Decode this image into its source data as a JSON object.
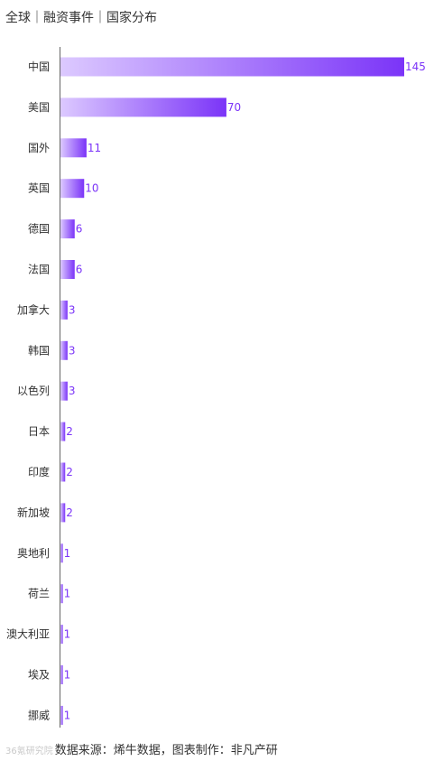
{
  "title": "全球｜融资事件｜国家分布",
  "footer": {
    "watermark": "36氪研究院",
    "source": "数据来源：烯牛数据，图表制作：非凡产研"
  },
  "colors": {
    "bar_start": "#dcc9ff",
    "bar_end": "#7b34f8",
    "label": "#7b34f8",
    "axis": "#666666",
    "text": "#333333"
  },
  "chart_data": {
    "type": "bar",
    "orientation": "horizontal",
    "title": "全球｜融资事件｜国家分布",
    "categories": [
      "中国",
      "美国",
      "国外",
      "英国",
      "德国",
      "法国",
      "加拿大",
      "韩国",
      "以色列",
      "日本",
      "印度",
      "新加坡",
      "奥地利",
      "荷兰",
      "澳大利亚",
      "埃及",
      "挪威"
    ],
    "values": [
      145,
      70,
      11,
      10,
      6,
      6,
      3,
      3,
      3,
      2,
      2,
      2,
      1,
      1,
      1,
      1,
      1
    ],
    "xlim": [
      0,
      145
    ],
    "grid": false,
    "data_labels": true
  }
}
